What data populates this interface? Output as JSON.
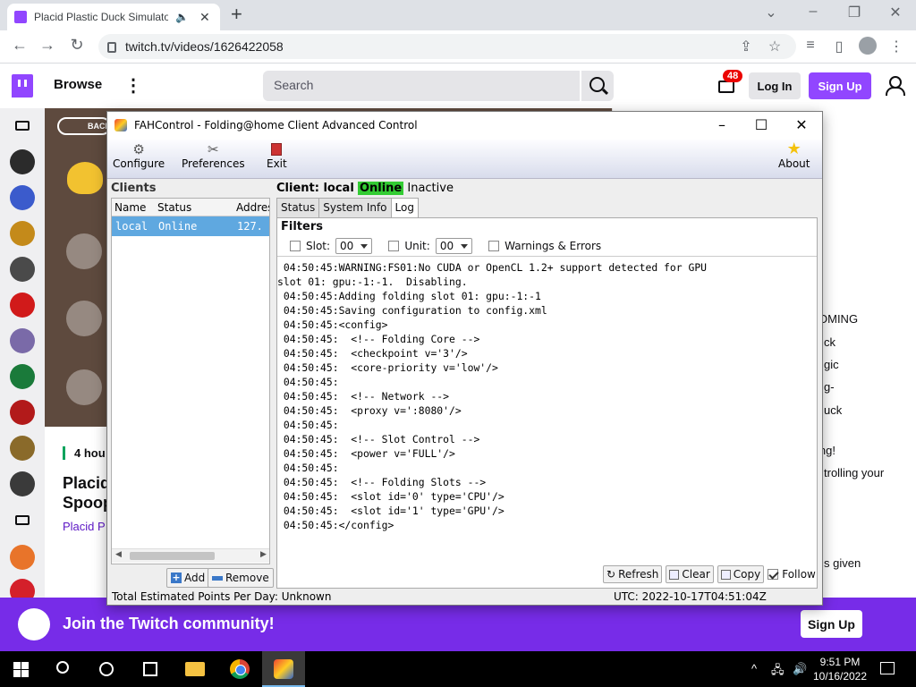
{
  "browser": {
    "tab_title": "Placid Plastic Duck Simulator",
    "url": "twitch.tv/videos/1626422058",
    "new_tab": "+"
  },
  "twitch": {
    "browse": "Browse",
    "search_placeholder": "Search",
    "notif_count": "48",
    "login": "Log In",
    "signup": "Sign Up",
    "back_label": "BACK",
    "time_ago": "4 hou",
    "video_title_line1": "Placid",
    "video_title_line2": "Spoop",
    "category": "Placid P",
    "right_panel_fragments": [
      "OMING",
      "ck",
      "gic",
      "g-",
      "uck",
      "ing!",
      "trolling your",
      "s given"
    ],
    "banner_text": "Join the Twitch community!",
    "banner_signup": "Sign Up"
  },
  "fah": {
    "title": "FAHControl - Folding@home Client Advanced Control",
    "toolbar": {
      "configure": "Configure",
      "preferences": "Preferences",
      "exit": "Exit",
      "about": "About"
    },
    "clients_heading": "Clients",
    "clients_columns": [
      "Name",
      "Status",
      "Addres"
    ],
    "clients_rows": [
      {
        "name": "local",
        "status": "Online",
        "address": "127."
      }
    ],
    "add_label": "Add",
    "remove_label": "Remove",
    "client_label": "Client: local",
    "client_status": "Online",
    "client_state": "Inactive",
    "tabs": [
      "Status",
      "System Info",
      "Log"
    ],
    "active_tab": "Log",
    "filters_heading": "Filters",
    "filter_slot_label": "Slot:",
    "filter_slot_value": "00",
    "filter_unit_label": "Unit:",
    "filter_unit_value": "00",
    "filter_warnings_label": "Warnings & Errors",
    "log_lines": [
      " 04:50:45:WARNING:FS01:No CUDA or OpenCL 1.2+ support detected for GPU",
      "slot 01: gpu:-1:-1.  Disabling.",
      " 04:50:45:Adding folding slot 01: gpu:-1:-1",
      " 04:50:45:Saving configuration to config.xml",
      " 04:50:45:<config>",
      " 04:50:45:  <!-- Folding Core -->",
      " 04:50:45:  <checkpoint v='3'/>",
      " 04:50:45:  <core-priority v='low'/>",
      " 04:50:45:",
      " 04:50:45:  <!-- Network -->",
      " 04:50:45:  <proxy v=':8080'/>",
      " 04:50:45:",
      " 04:50:45:  <!-- Slot Control -->",
      " 04:50:45:  <power v='FULL'/>",
      " 04:50:45:",
      " 04:50:45:  <!-- Folding Slots -->",
      " 04:50:45:  <slot id='0' type='CPU'/>",
      " 04:50:45:  <slot id='1' type='GPU'/>",
      " 04:50:45:</config>"
    ],
    "refresh_label": "Refresh",
    "clear_label": "Clear",
    "copy_label": "Copy",
    "follow_label": "Follow",
    "points_status": "Total Estimated Points Per Day: Unknown",
    "utc_status": "UTC: 2022-10-17T04:51:04Z"
  },
  "taskbar": {
    "time": "9:51 PM",
    "date": "10/16/2022"
  },
  "colors": {
    "twitch_purple": "#9146ff",
    "banner_purple": "#772ce8",
    "online_green": "#33cc33",
    "selection_blue": "#5fa8e0"
  }
}
